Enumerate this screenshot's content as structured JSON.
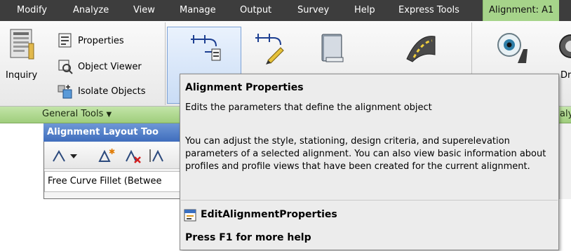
{
  "menu": {
    "items": [
      "Modify",
      "Analyze",
      "View",
      "Manage",
      "Output",
      "Survey",
      "Help",
      "Express Tools"
    ],
    "active_tab": "Alignment: A1"
  },
  "ribbon": {
    "inquiry_label": "Inquiry",
    "properties_label": "Properties",
    "object_viewer_label": "Object Viewer",
    "isolate_objects_label": "Isolate Objects",
    "general_tools_label": "General Tools",
    "right_panel_partial_label": "aly",
    "truncated_label": "Dr"
  },
  "layout_toolbar": {
    "title": "Alignment Layout Too",
    "status": "Free Curve Fillet (Betwee"
  },
  "tooltip": {
    "title": "Alignment Properties",
    "summary": "Edits the parameters that define the alignment object",
    "description": "You can adjust the style, stationing, design criteria, and superelevation parameters of a selected alignment. You can also view basic information about profiles and profile views that have been created for the current alignment.",
    "command": "EditAlignmentProperties",
    "help": "Press F1 for more help"
  },
  "colors": {
    "menu_bg": "#3d3d3d",
    "active_tab_bg": "#a6d48a",
    "panel_label_bg": "#b2d990",
    "toolbar_title_bg": "#4a78c4",
    "tooltip_bg": "#ececec"
  },
  "icons": [
    "inquiry-icon",
    "properties-icon",
    "object-viewer-icon",
    "isolate-objects-icon",
    "alignment-properties-icon",
    "geometry-editor-icon",
    "design-criteria-icon",
    "superelevation-icon",
    "sight-distance-icon",
    "drive-icon",
    "chevron-down-icon",
    "command-icon"
  ]
}
